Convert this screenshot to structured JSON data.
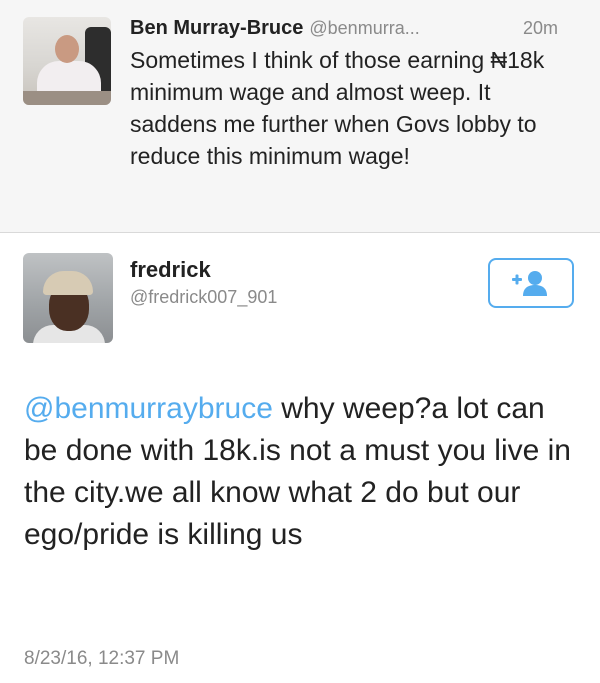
{
  "tweets": [
    {
      "name": "Ben Murray-Bruce",
      "handle": "@benmurra...",
      "time": "20m",
      "text": "Sometimes I think of those earning ₦18k minimum wage and almost weep. It saddens me further when Govs lobby to reduce this minimum wage!"
    },
    {
      "name": "fredrick",
      "handle": "@fredrick007_901",
      "mention": "@benmurraybruce",
      "text": " why weep?a lot can be done with 18k.is not a must you live in the city.we all know what 2 do but our ego/pride is killing us",
      "timestamp": "8/23/16, 12:37 PM",
      "follow_icon": "add-user-icon"
    }
  ],
  "colors": {
    "accent": "#55acee",
    "muted": "#8a8a8a",
    "text": "#222222",
    "header_background": "#f6f6f6"
  }
}
